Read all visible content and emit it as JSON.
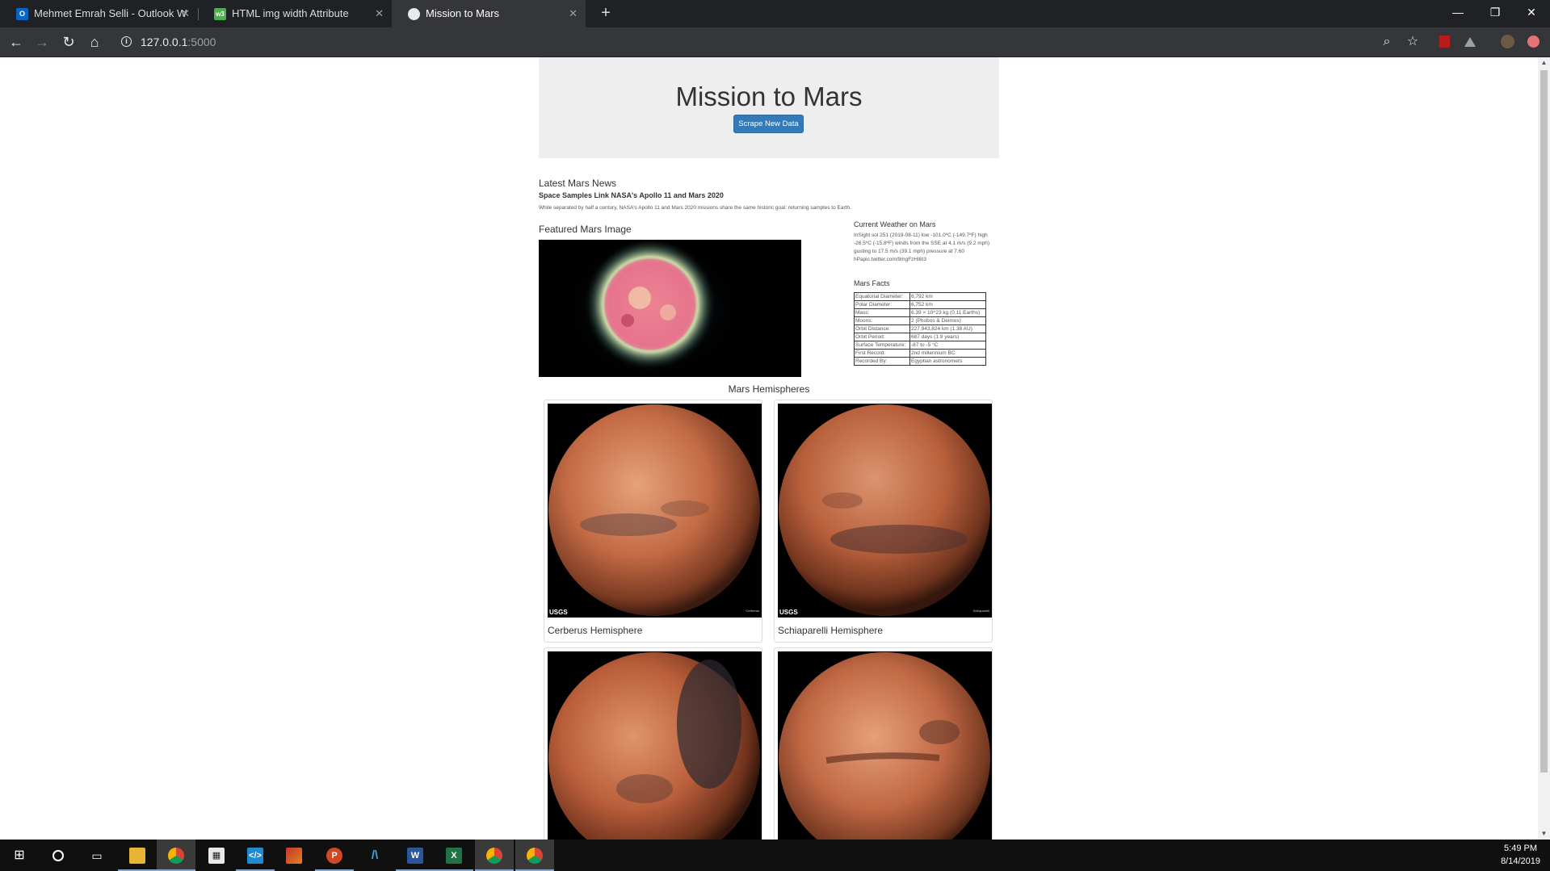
{
  "browser": {
    "tabs": [
      {
        "title": "Mehmet Emrah Selli - Outlook W",
        "icon": "outlook-icon",
        "active": false
      },
      {
        "title": "HTML img width Attribute",
        "icon": "w3schools-icon",
        "active": false
      },
      {
        "title": "Mission to Mars",
        "icon": "globe-icon",
        "active": true
      }
    ],
    "url_host": "127.0.0.1",
    "url_port": ":5000"
  },
  "page": {
    "title": "Mission to Mars",
    "scrape_button": "Scrape New Data",
    "news": {
      "heading": "Latest Mars News",
      "title": "Space Samples Link NASA's Apollo 11 and Mars 2020",
      "paragraph": "While separated by half a century, NASA's Apollo 11 and Mars 2020 missions share the same historic goal: returning samples to Earth."
    },
    "featured": {
      "heading": "Featured Mars Image"
    },
    "weather": {
      "heading": "Current Weather on Mars",
      "text": "InSight sol 251 (2019-08-11) low -101.0ºC (-149.7ºF) high -26.5ºC (-15.8ºF) winds from the SSE at 4.1 m/s (9.2 mph) gusting to 17.5 m/s (39.1 mph) pressure at 7.60 hPapic.twitter.com/9mgFzHI8I3"
    },
    "facts": {
      "heading": "Mars Facts",
      "rows": [
        {
          "k": "Equatorial Diameter:",
          "v": "6,792 km"
        },
        {
          "k": "Polar Diameter:",
          "v": "6,752 km"
        },
        {
          "k": "Mass:",
          "v": "6.39 × 10^23 kg (0.11 Earths)"
        },
        {
          "k": "Moons:",
          "v": "2 (Phobos & Deimos)"
        },
        {
          "k": "Orbit Distance:",
          "v": "227,943,824 km (1.38 AU)"
        },
        {
          "k": "Orbit Period:",
          "v": "687 days (1.9 years)"
        },
        {
          "k": "Surface Temperature:",
          "v": "-87 to -5 °C"
        },
        {
          "k": "First Record:",
          "v": "2nd millennium BC"
        },
        {
          "k": "Recorded By:",
          "v": "Egyptian astronomers"
        }
      ]
    },
    "hemispheres": {
      "heading": "Mars Hemispheres",
      "items": [
        {
          "title": "Cerberus Hemisphere",
          "logo": "USGS",
          "credit": "Cerberus"
        },
        {
          "title": "Schiaparelli Hemisphere",
          "logo": "USGS",
          "credit": "Schiaparelli"
        },
        {
          "title": "",
          "logo": "",
          "credit": ""
        },
        {
          "title": "",
          "logo": "",
          "credit": ""
        }
      ]
    }
  },
  "taskbar": {
    "apps": [
      "windows-start-icon",
      "cortana-icon",
      "task-view-icon",
      "file-explorer-icon",
      "chrome-icon",
      "calculator-icon",
      "vscode-icon",
      "matlab-icon",
      "powerpoint-icon",
      "pycharm-icon",
      "word-icon",
      "excel-icon",
      "chrome-icon",
      "chrome-icon"
    ],
    "time": "5:49 PM",
    "date": "8/14/2019"
  },
  "colors": {
    "accent_button": "#337ab7",
    "jumbotron": "#eeeeee",
    "chrome_dark": "#202124"
  }
}
